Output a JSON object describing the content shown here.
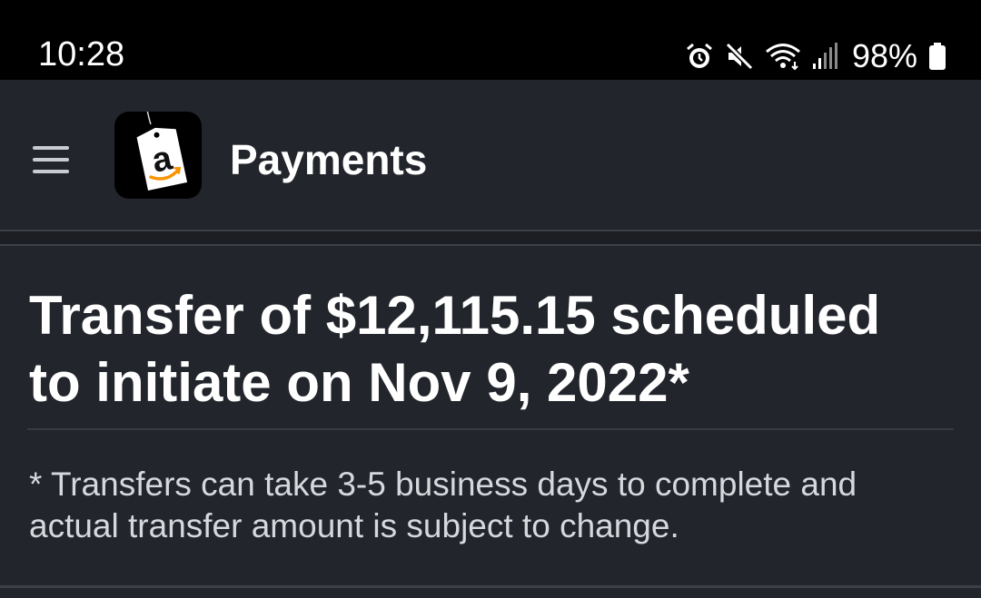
{
  "status_bar": {
    "time": "10:28",
    "battery": "98%",
    "icons": [
      "alarm-icon",
      "mute-icon",
      "wifi-icon",
      "signal-icon",
      "battery-icon"
    ]
  },
  "app_bar": {
    "title": "Payments",
    "menu_icon": "hamburger-menu-icon",
    "logo_letter": "a"
  },
  "transfer": {
    "headline": "Transfer of $12,115.15 scheduled to initiate on Nov 9, 2022*",
    "note": "* Transfers can take 3-5 business days to complete and actual transfer amount is subject to change."
  },
  "colors": {
    "background": "#22252b",
    "status_bar": "#000000",
    "text_primary": "#ffffff",
    "text_secondary": "#d6d8dc",
    "amazon_orange": "#f79400"
  }
}
